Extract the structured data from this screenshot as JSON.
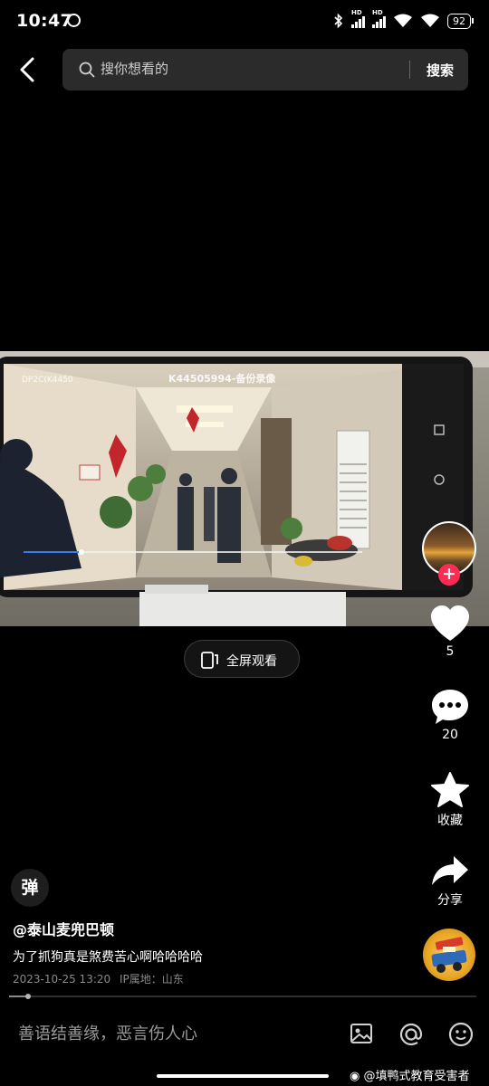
{
  "status_bar": {
    "time": "10:47",
    "battery": "92"
  },
  "search": {
    "placeholder": "搜你想看的",
    "button_label": "搜索"
  },
  "video": {
    "fullscreen_label": "全屏观看"
  },
  "actions": {
    "like_count": "5",
    "comment_count": "20",
    "favorite_label": "收藏",
    "share_label": "分享"
  },
  "post": {
    "danmaku_label": "弹",
    "author": "@泰山麦兜巴顿",
    "caption": "为了抓狗真是煞费苦心啊哈哈哈哈",
    "timestamp": "2023-10-25 13:20",
    "ip_location": "IP属地：山东"
  },
  "progress": {
    "fraction": 0.04
  },
  "comment_bar": {
    "placeholder": "善语结善缘，恶言伤人心"
  },
  "video_overlay": {
    "title": "K44505994-备份录像",
    "device": "DP2C(K4450"
  },
  "watermark": "@填鸭式教育受害者",
  "icons": [
    "back-icon",
    "search-icon",
    "fullscreen-icon",
    "heart-icon",
    "comment-icon",
    "star-icon",
    "share-icon",
    "image-icon",
    "mention-icon",
    "emoji-icon"
  ],
  "colors": {
    "background": "#000000",
    "search_bg": "#2b2b2b",
    "follow_red": "#ff2b55",
    "muted_text": "#8a8a8a"
  }
}
